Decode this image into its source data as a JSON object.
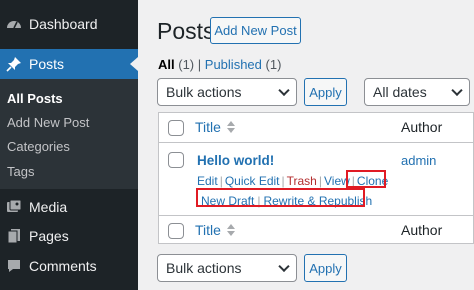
{
  "sidebar": {
    "dashboard": {
      "label": "Dashboard",
      "icon": "dashboard-icon"
    },
    "posts": {
      "label": "Posts",
      "icon": "pin-icon"
    },
    "submenu": [
      "All Posts",
      "Add New Post",
      "Categories",
      "Tags"
    ],
    "media": {
      "label": "Media",
      "icon": "media-icon"
    },
    "pages": {
      "label": "Pages",
      "icon": "pages-icon"
    },
    "comments": {
      "label": "Comments",
      "icon": "comments-icon"
    }
  },
  "header": {
    "title": "Posts",
    "add_new": "Add New Post"
  },
  "filters": {
    "all_label": "All",
    "all_count": "(1)",
    "separator": "|",
    "published_label": "Published",
    "published_count": "(1)"
  },
  "bulk": {
    "top_value": "Bulk actions",
    "bottom_value": "Bulk actions",
    "apply": "Apply",
    "dates_value": "All dates"
  },
  "table": {
    "col_title": "Title",
    "col_author": "Author",
    "post": {
      "title": "Hello world!",
      "author": "admin",
      "actions": [
        "Edit",
        "Quick Edit",
        "Trash",
        "View",
        "Clone"
      ],
      "actions_2": [
        "New Draft",
        "Rewrite & Republish"
      ]
    }
  },
  "colors": {
    "sidebar_bg": "#1d2327",
    "accent": "#2271b1",
    "highlight": "#e01b24",
    "trash": "#b32d2e"
  }
}
